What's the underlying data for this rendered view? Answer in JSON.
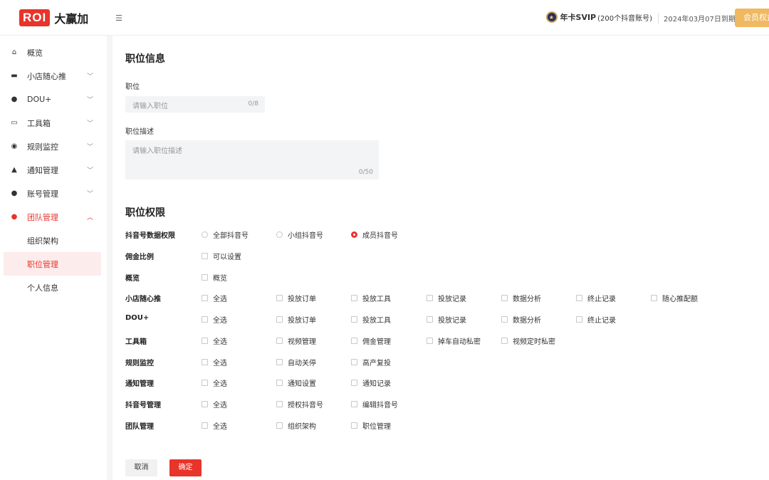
{
  "header": {
    "logo_mark": "ROI",
    "logo_text": "大赢加",
    "vip_title": "年卡SVIP",
    "vip_sub": "(200个抖音账号)",
    "expire": "2024年03月07日到期",
    "member_button": "会员权益"
  },
  "sidebar": {
    "items": [
      {
        "label": "概览",
        "icon": "home-icon",
        "caret": false
      },
      {
        "label": "小店随心推",
        "icon": "shop-icon",
        "caret": true
      },
      {
        "label": "DOU+",
        "icon": "flame-icon",
        "caret": true
      },
      {
        "label": "工具箱",
        "icon": "toolbox-icon",
        "caret": true
      },
      {
        "label": "规则监控",
        "icon": "monitor-icon",
        "caret": true
      },
      {
        "label": "通知管理",
        "icon": "bell-icon",
        "caret": true
      },
      {
        "label": "账号管理",
        "icon": "user-icon",
        "caret": true
      },
      {
        "label": "团队管理",
        "icon": "team-icon",
        "caret": true
      }
    ],
    "sub_items": [
      "组织架构",
      "职位管理",
      "个人信息"
    ],
    "active_sub": "职位管理"
  },
  "form": {
    "section_info": "职位信息",
    "position_label": "职位",
    "position_placeholder": "请输入职位",
    "position_counter": "0/8",
    "desc_label": "职位描述",
    "desc_placeholder": "请输入职位描述",
    "desc_counter": "0/50",
    "section_perm": "职位权限"
  },
  "permissions": {
    "data_scope": {
      "label": "抖音号数据权限",
      "options": [
        "全部抖音号",
        "小组抖音号",
        "成员抖音号"
      ],
      "selected": "成员抖音号"
    },
    "rows": [
      {
        "label": "佣金比例",
        "options": [
          "可以设置"
        ]
      },
      {
        "label": "概览",
        "options": [
          "概览"
        ]
      },
      {
        "label": "小店随心推",
        "options": [
          "全选",
          "投放订单",
          "投放工具",
          "投放记录",
          "数据分析",
          "终止记录",
          "随心推配额"
        ]
      },
      {
        "label": "DOU+",
        "options": [
          "全选",
          "投放订单",
          "投放工具",
          "投放记录",
          "数据分析",
          "终止记录"
        ]
      },
      {
        "label": "工具箱",
        "options": [
          "全选",
          "视频管理",
          "佣金管理",
          "掉车自动私密",
          "视频定时私密"
        ]
      },
      {
        "label": "规则监控",
        "options": [
          "全选",
          "自动关停",
          "高产复投"
        ]
      },
      {
        "label": "通知管理",
        "options": [
          "全选",
          "通知设置",
          "通知记录"
        ]
      },
      {
        "label": "抖音号管理",
        "options": [
          "全选",
          "授权抖音号",
          "编辑抖音号"
        ]
      },
      {
        "label": "团队管理",
        "options": [
          "全选",
          "组织架构",
          "职位管理"
        ]
      }
    ]
  },
  "buttons": {
    "cancel": "取消",
    "confirm": "确定"
  }
}
